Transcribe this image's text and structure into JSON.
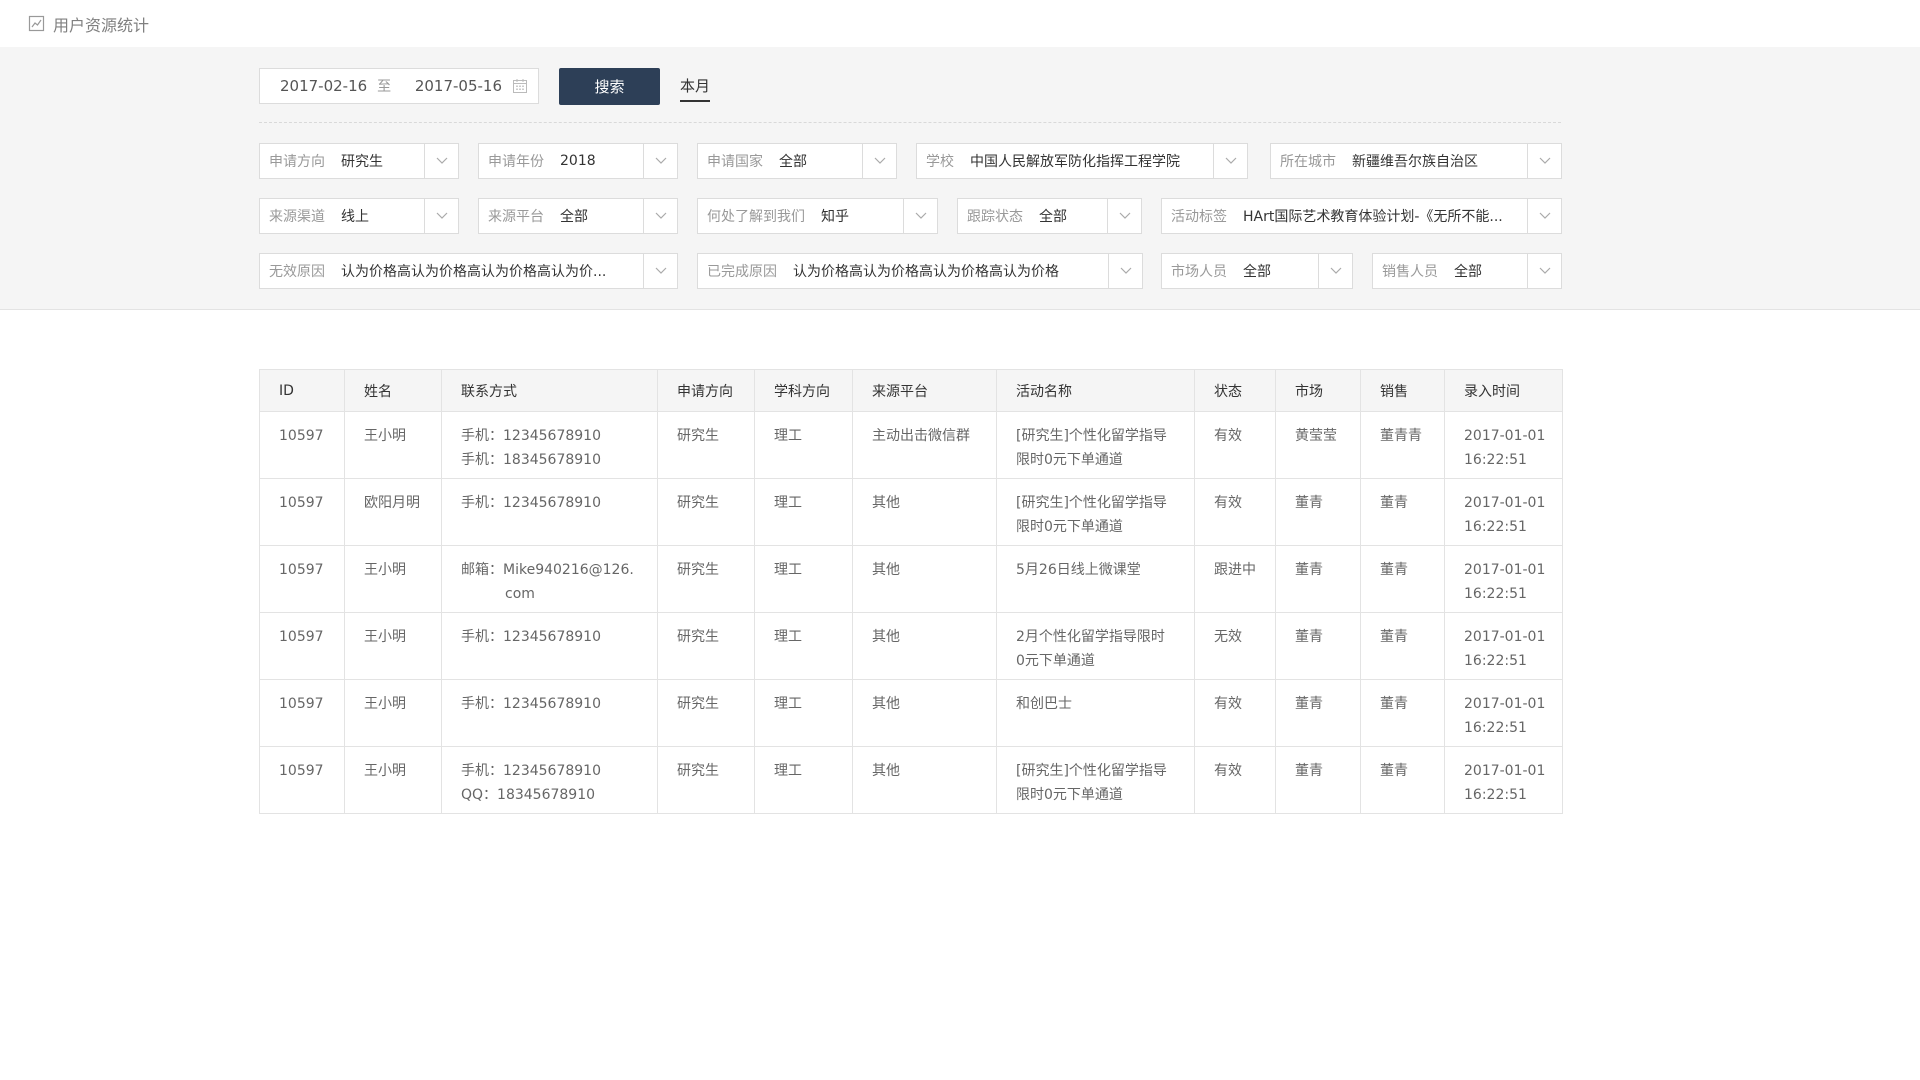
{
  "header": {
    "title": "用户资源统计",
    "icon": "chart-icon"
  },
  "date_filter": {
    "start": "2017-02-16",
    "to": "至",
    "end": "2017-05-16",
    "search_label": "搜索",
    "month_label": "本月"
  },
  "filters": {
    "apply_direction": {
      "label": "申请方向",
      "value": "研究生"
    },
    "apply_year": {
      "label": "申请年份",
      "value": "2018"
    },
    "apply_country": {
      "label": "申请国家",
      "value": "全部"
    },
    "school": {
      "label": "学校",
      "value": "中国人民解放军防化指挥工程学院"
    },
    "city": {
      "label": "所在城市",
      "value": "新疆维吾尔族自治区"
    },
    "source_channel": {
      "label": "来源渠道",
      "value": "线上"
    },
    "source_platform": {
      "label": "来源平台",
      "value": "全部"
    },
    "where_heard": {
      "label": "何处了解到我们",
      "value": "知乎"
    },
    "track_status": {
      "label": "跟踪状态",
      "value": "全部"
    },
    "activity_tag": {
      "label": "活动标签",
      "value": "HArt国际艺术教育体验计划-《无所不能..."
    },
    "invalid_reason": {
      "label": "无效原因",
      "value": "认为价格高认为价格高认为价格高认为价..."
    },
    "completed_reason": {
      "label": "已完成原因",
      "value": "认为价格高认为价格高认为价格高认为价格"
    },
    "marketing_staff": {
      "label": "市场人员",
      "value": "全部"
    },
    "sales_staff": {
      "label": "销售人员",
      "value": "全部"
    }
  },
  "table": {
    "columns": [
      "ID",
      "姓名",
      "联系方式",
      "申请方向",
      "学科方向",
      "来源平台",
      "活动名称",
      "状态",
      "市场",
      "销售",
      "录入时间"
    ],
    "rows": [
      {
        "id": "10597",
        "name": "王小明",
        "contact": [
          "手机：12345678910",
          "手机：18345678910"
        ],
        "direction": "研究生",
        "subject": "理工",
        "platform": "主动出击微信群",
        "activity": [
          "[研究生]个性化留学指导",
          "限时0元下单通道"
        ],
        "status": "有效",
        "market": "黄莹莹",
        "sales": "董青青",
        "time": [
          "2017-01-01",
          "16:22:51"
        ]
      },
      {
        "id": "10597",
        "name": "欧阳月明",
        "contact": [
          "手机：12345678910"
        ],
        "direction": "研究生",
        "subject": "理工",
        "platform": "其他",
        "activity": [
          "[研究生]个性化留学指导",
          "限时0元下单通道"
        ],
        "status": "有效",
        "market": "董青",
        "sales": "董青",
        "time": [
          "2017-01-01",
          "16:22:51"
        ]
      },
      {
        "id": "10597",
        "name": "王小明",
        "contact": [
          "邮箱：Mike940216@126.",
          "com"
        ],
        "direction": "研究生",
        "subject": "理工",
        "platform": "其他",
        "activity": [
          "5月26日线上微课堂"
        ],
        "status": "跟进中",
        "market": "董青",
        "sales": "董青",
        "time": [
          "2017-01-01",
          "16:22:51"
        ]
      },
      {
        "id": "10597",
        "name": "王小明",
        "contact": [
          "手机：12345678910"
        ],
        "direction": "研究生",
        "subject": "理工",
        "platform": "其他",
        "activity": [
          "2月个性化留学指导限时",
          "0元下单通道"
        ],
        "status": "无效",
        "market": "董青",
        "sales": "董青",
        "time": [
          "2017-01-01",
          "16:22:51"
        ]
      },
      {
        "id": "10597",
        "name": "王小明",
        "contact": [
          "手机：12345678910"
        ],
        "direction": "研究生",
        "subject": "理工",
        "platform": "其他",
        "activity": [
          "和创巴士"
        ],
        "status": "有效",
        "market": "董青",
        "sales": "董青",
        "time": [
          "2017-01-01",
          "16:22:51"
        ]
      },
      {
        "id": "10597",
        "name": "王小明",
        "contact": [
          "手机：12345678910",
          "QQ：18345678910"
        ],
        "direction": "研究生",
        "subject": "理工",
        "platform": "其他",
        "activity": [
          "[研究生]个性化留学指导",
          "限时0元下单通道"
        ],
        "status": "有效",
        "market": "董青",
        "sales": "董青",
        "time": [
          "2017-01-01",
          "16:22:51"
        ]
      }
    ]
  }
}
